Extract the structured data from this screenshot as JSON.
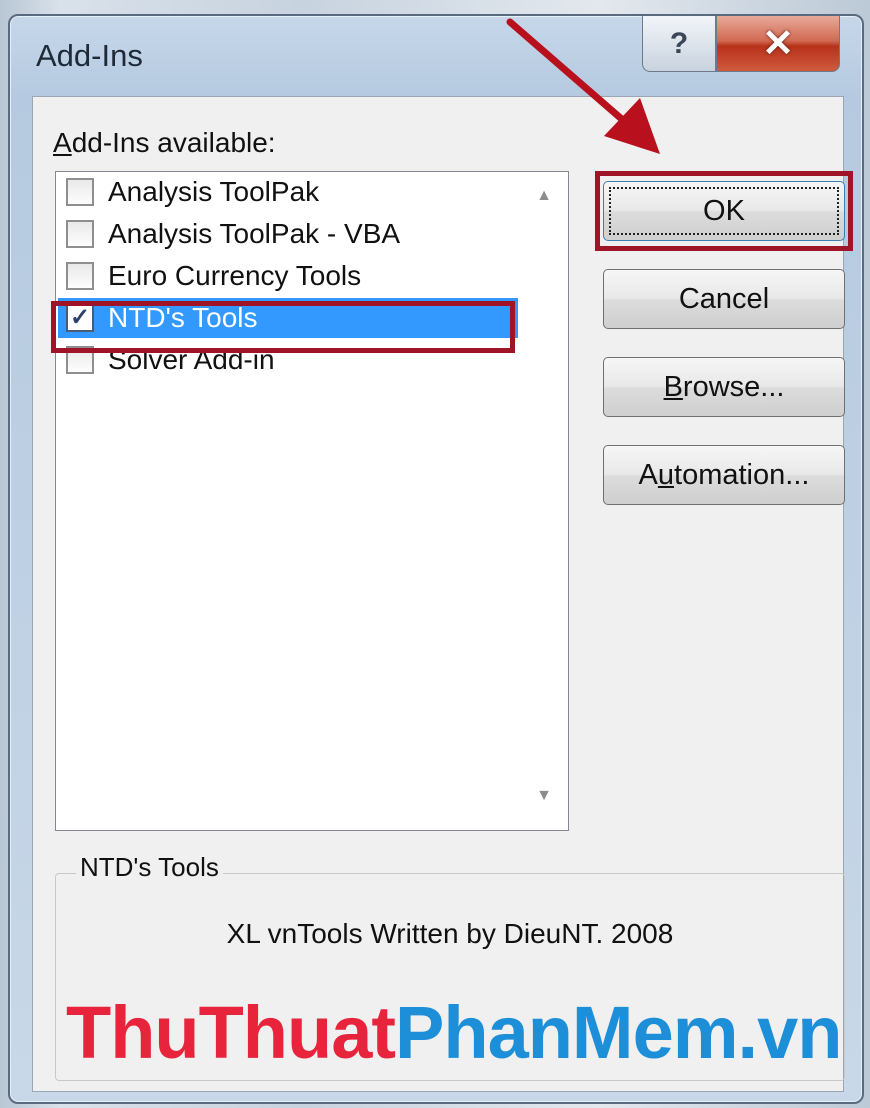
{
  "window": {
    "title": "Add-Ins",
    "help_glyph": "?",
    "close_glyph": "✕"
  },
  "list": {
    "label_accel": "A",
    "label_rest": "dd-Ins available:",
    "items": [
      {
        "label": "Analysis ToolPak",
        "checked": false
      },
      {
        "label": "Analysis ToolPak - VBA",
        "checked": false
      },
      {
        "label": "Euro Currency Tools",
        "checked": false
      },
      {
        "label": "NTD's Tools",
        "checked": true,
        "selected": true
      },
      {
        "label": "Solver Add-in",
        "checked": false
      }
    ],
    "scroll_up_glyph": "▲",
    "scroll_down_glyph": "▼",
    "check_glyph": "✓"
  },
  "buttons": {
    "ok": "OK",
    "cancel": "Cancel",
    "browse_accel": "B",
    "browse_rest": "rowse...",
    "automation_pre": "A",
    "automation_accel": "u",
    "automation_rest": "tomation..."
  },
  "details": {
    "legend": "NTD's Tools",
    "description": "XL vnTools Written by DieuNT. 2008"
  },
  "watermark": {
    "part1": "ThuThuat",
    "part2": "PhanMem.vn"
  },
  "colors": {
    "highlight": "#a01428",
    "selection": "#3399ff",
    "watermark_red": "#e8243c",
    "watermark_blue": "#1d8fd9"
  }
}
